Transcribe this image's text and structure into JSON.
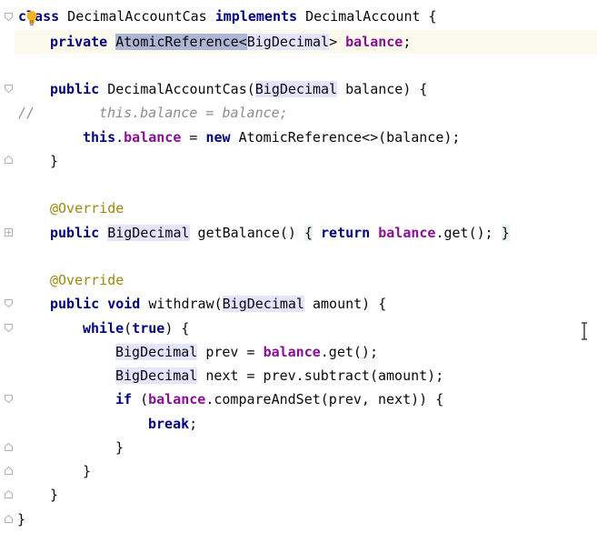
{
  "editor": {
    "lines": {
      "l1": {
        "kw_class": "class",
        "name": " DecimalAccountCas ",
        "kw_impl": "implements",
        "iface": " DecimalAccount {"
      },
      "l2": {
        "kw_private": "private",
        "sp": " ",
        "type": "AtomicReference",
        "lt": "<",
        "gen": "BigDecimal",
        "gt": ">",
        "sp2": " ",
        "field": "balance",
        "semi": ";"
      },
      "l4": {
        "kw_public": "public",
        "rest1": " DecimalAccountCas(",
        "type": "BigDecimal",
        "rest2": " balance) {"
      },
      "l5": {
        "slashes": "//",
        "text": "this.balance = balance;"
      },
      "l6": {
        "kw_this": "this",
        "dot": ".",
        "field": "balance",
        "eq": " = ",
        "kw_new": "new",
        "rest": " AtomicReference<>(balance);"
      },
      "l7": {
        "text": "}"
      },
      "l9": {
        "text": "@Override"
      },
      "l10": {
        "kw_public": "public",
        "sp": " ",
        "type": "BigDecimal",
        "mid": " getBalance() ",
        "lb": "{",
        "sp2": " ",
        "kw_return": "return",
        "sp3": " ",
        "field": "balance",
        "rest": ".get(); ",
        "rb": "}"
      },
      "l12": {
        "text": "@Override"
      },
      "l13": {
        "kw_public": "public",
        "sp": " ",
        "kw_void": "void",
        "rest1": " withdraw(",
        "type": "BigDecimal",
        "rest2": " amount) {"
      },
      "l14": {
        "kw_while": "while",
        "lp": "(",
        "kw_true": "true",
        "rest": ") {"
      },
      "l15": {
        "type": "BigDecimal",
        "mid": " prev = ",
        "field": "balance",
        "rest": ".get();"
      },
      "l16": {
        "type": "BigDecimal",
        "rest": " next = prev.subtract(amount);"
      },
      "l17": {
        "kw_if": "if",
        "lp": " (",
        "field": "balance",
        "rest": ".compareAndSet(prev, next)) {"
      },
      "l18": {
        "kw_break": "break",
        "rest": ";"
      },
      "l19": {
        "text": "}"
      },
      "l20": {
        "text": "}"
      },
      "l21": {
        "text": "}"
      },
      "l22": {
        "text": "}"
      }
    }
  }
}
